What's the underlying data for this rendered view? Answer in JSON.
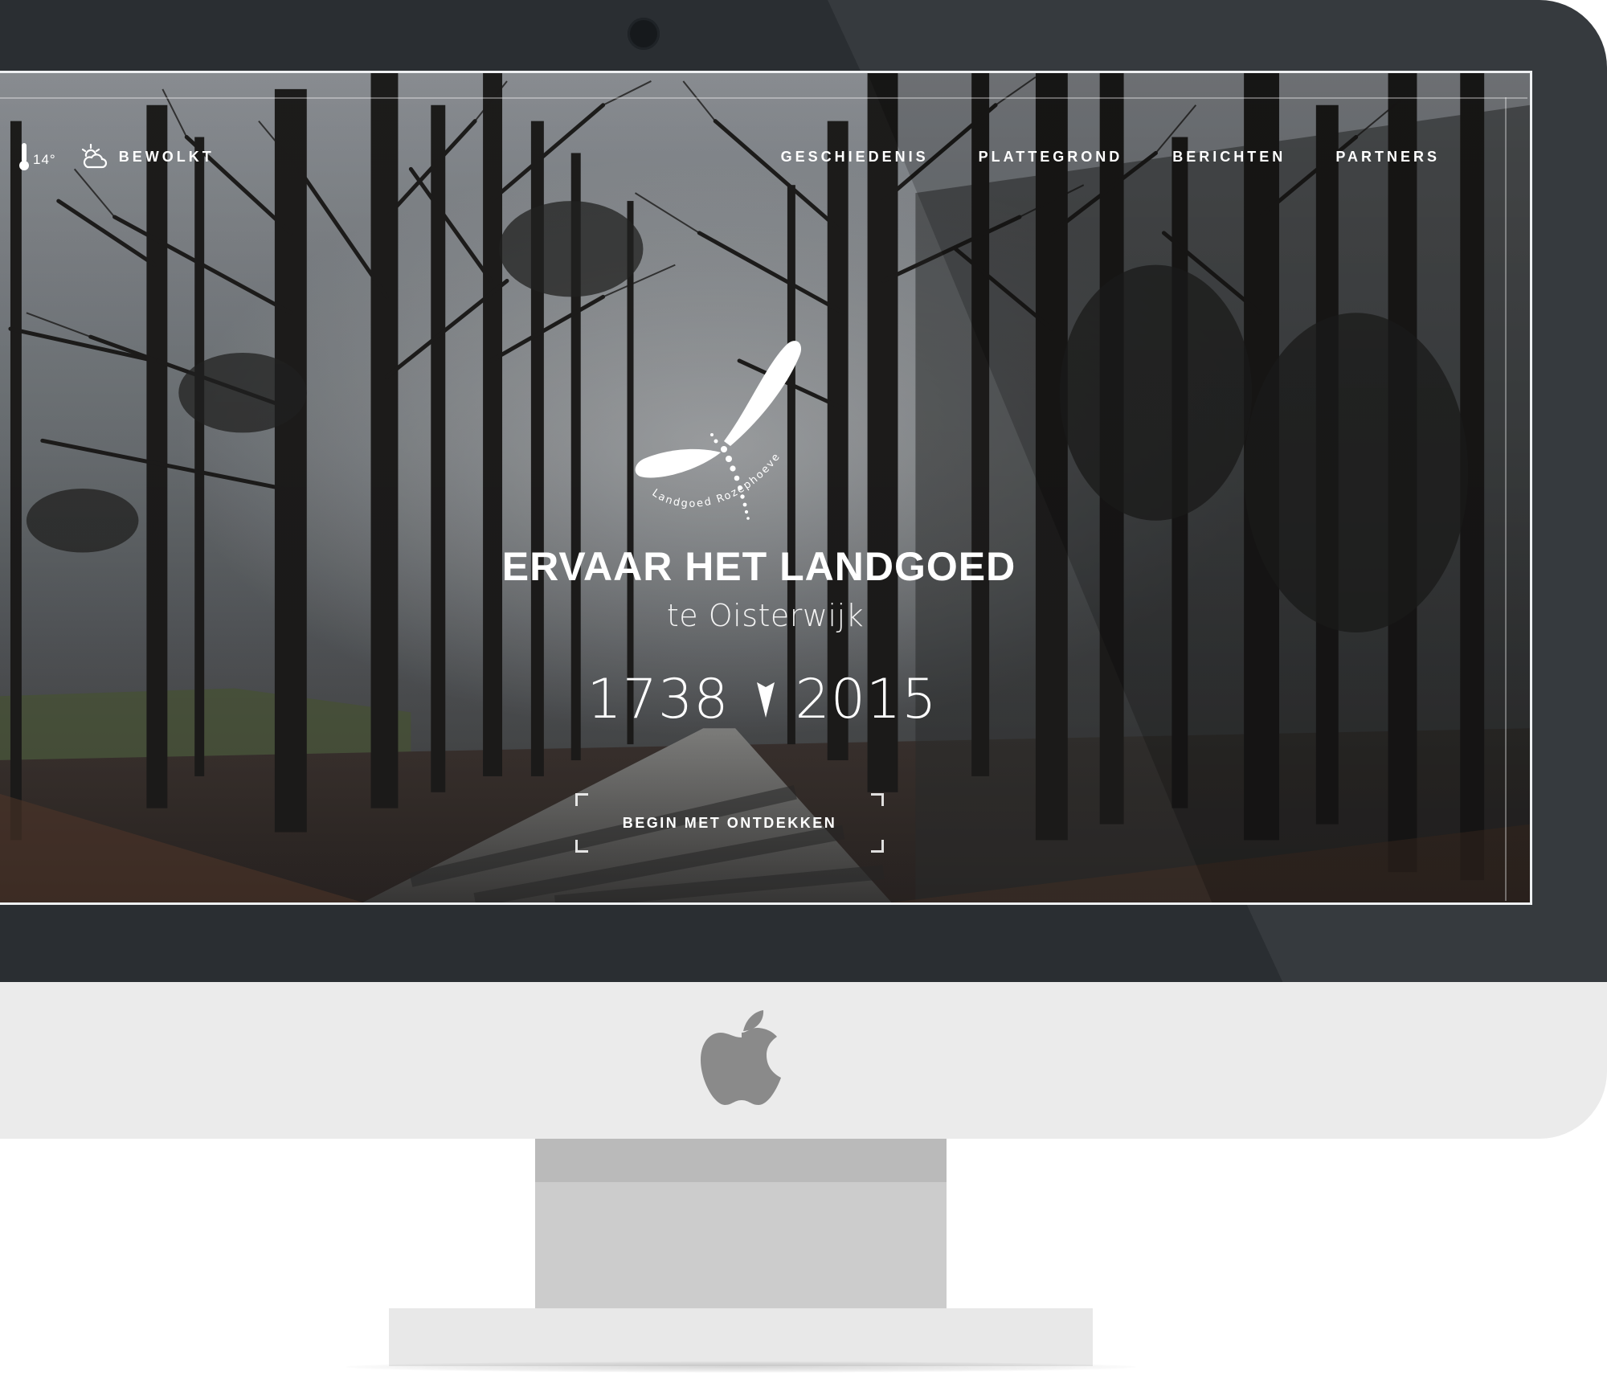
{
  "weather": {
    "temperature": "14°",
    "condition": "BEWOLKT",
    "temperature_icon": "thermometer-icon",
    "condition_icon": "partly-cloudy-icon"
  },
  "nav": {
    "items": [
      {
        "label": "GESCHIEDENIS"
      },
      {
        "label": "PLATTEGROND"
      },
      {
        "label": "BERICHTEN"
      },
      {
        "label": "PARTNERS"
      }
    ]
  },
  "logo": {
    "icon": "dragonfly-logo-icon",
    "wordmark": "Landgoed Rozephoeve"
  },
  "hero": {
    "title": "ERVAAR HET LANDGOED",
    "subtitle": "te Oisterwijk",
    "year_start": "1738",
    "year_end": "2015",
    "years_separator_icon": "arrow-down-icon",
    "cta_label": "BEGIN MET ONTDEKKEN"
  },
  "device": {
    "brand_icon": "apple-logo-icon"
  },
  "colors": {
    "bezel": "#2a2e32",
    "chin": "#ebebeb",
    "stand": "#cccccc",
    "text": "#ffffff"
  }
}
